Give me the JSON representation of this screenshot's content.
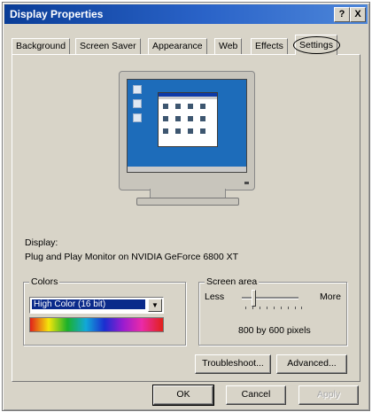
{
  "window": {
    "title": "Display Properties",
    "help_label": "?",
    "close_label": "X"
  },
  "tabs": [
    {
      "label": "Background"
    },
    {
      "label": "Screen Saver"
    },
    {
      "label": "Appearance"
    },
    {
      "label": "Web"
    },
    {
      "label": "Effects"
    },
    {
      "label": "Settings",
      "active": true
    }
  ],
  "display": {
    "label": "Display:",
    "device": "Plug and Play Monitor on NVIDIA GeForce 6800 XT"
  },
  "colors": {
    "group_title": "Colors",
    "selected": "High Color (16 bit)"
  },
  "screen_area": {
    "group_title": "Screen area",
    "less_label": "Less",
    "more_label": "More",
    "resolution": "800 by 600 pixels",
    "slider_fraction": 0.2
  },
  "buttons": {
    "troubleshoot": "Troubleshoot...",
    "advanced": "Advanced...",
    "ok": "OK",
    "cancel": "Cancel",
    "apply": "Apply"
  },
  "colors_accent": {
    "titlebar": "#0a3d97",
    "selection": "#0a2a8a",
    "dialog_bg": "#d8d4c8"
  }
}
